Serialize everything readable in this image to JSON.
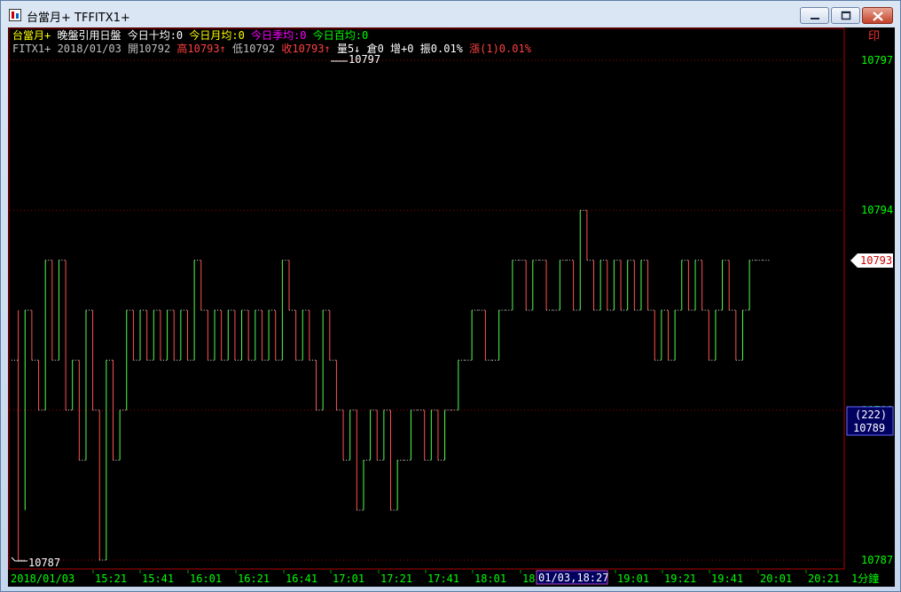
{
  "window": {
    "title": "台當月+ TFFITX1+"
  },
  "info_line1": [
    {
      "text": "台當月+",
      "color": "#ffff00"
    },
    {
      "text": "晚盤引用日盤",
      "color": "#ffffff"
    },
    {
      "text": "今日十均:0",
      "color": "#ffffff"
    },
    {
      "text": "今日月均:0",
      "color": "#ffff00"
    },
    {
      "text": "今日季均:0",
      "color": "#ff00ff"
    },
    {
      "text": "今日百均:0",
      "color": "#00ff00"
    }
  ],
  "info_line2": [
    {
      "text": "FITX1+",
      "color": "#c0c0c0"
    },
    {
      "text": "2018/01/03",
      "color": "#c0c0c0"
    },
    {
      "text": "開10792",
      "color": "#c0c0c0"
    },
    {
      "text": "高10793↑",
      "color": "#ff4040"
    },
    {
      "text": "低10792",
      "color": "#c0c0c0"
    },
    {
      "text": "收10793↑",
      "color": "#ff4040"
    },
    {
      "text": "量5↓",
      "color": "#ffffff"
    },
    {
      "text": "倉0",
      "color": "#ffffff"
    },
    {
      "text": "增+0",
      "color": "#ffffff"
    },
    {
      "text": "振0.01%",
      "color": "#ffffff"
    },
    {
      "text": "漲(1)0.01%",
      "color": "#ff4040"
    }
  ],
  "print_button": "印",
  "chart_data": {
    "type": "bar",
    "subtype": "1-minute price ticks",
    "symbol": "FITX1+",
    "date": "2018/01/03",
    "y_ticks": [
      10797,
      10794,
      10790,
      10787
    ],
    "ylim": [
      10786.5,
      10797.8
    ],
    "x_tick_labels": [
      "2018/01/03",
      "15:21",
      "15:41",
      "16:01",
      "16:21",
      "16:41",
      "17:01",
      "17:21",
      "17:41",
      "18:01",
      "18",
      "19:01",
      "19:21",
      "19:41",
      "20:01",
      "20:21"
    ],
    "x_label_right": "1分鐘",
    "cursor_time_label": "01/03,18:27",
    "last_price_marker": "10793",
    "cursor_info": {
      "count": "(222)",
      "price": "10789"
    },
    "high_label": "10797",
    "low_label": "10787",
    "segments": [
      [
        0,
        2,
        10791,
        10791
      ],
      [
        2,
        4,
        10792,
        10787
      ],
      [
        4,
        6,
        10788,
        10792
      ],
      [
        6,
        8,
        10792,
        10791
      ],
      [
        8,
        10,
        10791,
        10790
      ],
      [
        10,
        12,
        10790,
        10793
      ],
      [
        12,
        14,
        10793,
        10791
      ],
      [
        14,
        16,
        10791,
        10793
      ],
      [
        16,
        18,
        10793,
        10790
      ],
      [
        18,
        20,
        10790,
        10791
      ],
      [
        20,
        22,
        10791,
        10789
      ],
      [
        22,
        24,
        10789,
        10792
      ],
      [
        24,
        26,
        10792,
        10790
      ],
      [
        26,
        28,
        10790,
        10787
      ],
      [
        28,
        30,
        10787,
        10791
      ],
      [
        30,
        32,
        10791,
        10789
      ],
      [
        32,
        34,
        10789,
        10790
      ],
      [
        34,
        36,
        10790,
        10792
      ],
      [
        36,
        38,
        10792,
        10791
      ],
      [
        38,
        40,
        10791,
        10792
      ],
      [
        40,
        42,
        10792,
        10791
      ],
      [
        42,
        44,
        10791,
        10792
      ],
      [
        44,
        46,
        10792,
        10791
      ],
      [
        46,
        48,
        10791,
        10792
      ],
      [
        48,
        50,
        10792,
        10791
      ],
      [
        50,
        52,
        10791,
        10792
      ],
      [
        52,
        54,
        10792,
        10791
      ],
      [
        54,
        56,
        10791,
        10793
      ],
      [
        56,
        58,
        10793,
        10792
      ],
      [
        58,
        60,
        10792,
        10791
      ],
      [
        60,
        62,
        10791,
        10792
      ],
      [
        62,
        64,
        10792,
        10791
      ],
      [
        64,
        66,
        10791,
        10792
      ],
      [
        66,
        68,
        10792,
        10791
      ],
      [
        68,
        70,
        10791,
        10792
      ],
      [
        70,
        72,
        10792,
        10791
      ],
      [
        72,
        74,
        10791,
        10792
      ],
      [
        74,
        76,
        10792,
        10791
      ],
      [
        76,
        78,
        10791,
        10792
      ],
      [
        78,
        80,
        10792,
        10791
      ],
      [
        80,
        82,
        10791,
        10793
      ],
      [
        82,
        84,
        10793,
        10792
      ],
      [
        84,
        86,
        10792,
        10791
      ],
      [
        86,
        88,
        10791,
        10792
      ],
      [
        88,
        90,
        10792,
        10791
      ],
      [
        90,
        92,
        10791,
        10790
      ],
      [
        92,
        94,
        10790,
        10792
      ],
      [
        94,
        96,
        10792,
        10791
      ],
      [
        96,
        98,
        10791,
        10790
      ],
      [
        98,
        100,
        10790,
        10789
      ],
      [
        100,
        102,
        10789,
        10790
      ],
      [
        102,
        104,
        10790,
        10788
      ],
      [
        104,
        106,
        10788,
        10789
      ],
      [
        106,
        108,
        10789,
        10790
      ],
      [
        108,
        110,
        10790,
        10789
      ],
      [
        110,
        112,
        10789,
        10790
      ],
      [
        112,
        114,
        10790,
        10788
      ],
      [
        114,
        116,
        10788,
        10789
      ],
      [
        116,
        118,
        10789,
        10789
      ],
      [
        118,
        120,
        10789,
        10790
      ],
      [
        120,
        122,
        10790,
        10790
      ],
      [
        122,
        124,
        10790,
        10789
      ],
      [
        124,
        126,
        10789,
        10790
      ],
      [
        126,
        128,
        10790,
        10789
      ],
      [
        128,
        130,
        10789,
        10790
      ],
      [
        130,
        132,
        10790,
        10790
      ],
      [
        132,
        134,
        10790,
        10791
      ],
      [
        134,
        136,
        10791,
        10791
      ],
      [
        136,
        138,
        10791,
        10792
      ],
      [
        138,
        140,
        10792,
        10792
      ],
      [
        140,
        142,
        10792,
        10791
      ],
      [
        142,
        144,
        10791,
        10791
      ],
      [
        144,
        146,
        10791,
        10792
      ],
      [
        146,
        148,
        10792,
        10792
      ],
      [
        148,
        150,
        10792,
        10793
      ],
      [
        150,
        152,
        10793,
        10793
      ],
      [
        152,
        154,
        10793,
        10792
      ],
      [
        154,
        156,
        10792,
        10793
      ],
      [
        156,
        158,
        10793,
        10793
      ],
      [
        158,
        160,
        10793,
        10792
      ],
      [
        160,
        162,
        10792,
        10792
      ],
      [
        162,
        164,
        10792,
        10793
      ],
      [
        164,
        166,
        10793,
        10793
      ],
      [
        166,
        168,
        10793,
        10792
      ],
      [
        168,
        170,
        10792,
        10794
      ],
      [
        170,
        172,
        10794,
        10793
      ],
      [
        172,
        174,
        10793,
        10792
      ],
      [
        174,
        176,
        10792,
        10793
      ],
      [
        176,
        178,
        10793,
        10792
      ],
      [
        178,
        180,
        10792,
        10793
      ],
      [
        180,
        182,
        10793,
        10792
      ],
      [
        182,
        184,
        10792,
        10793
      ],
      [
        184,
        186,
        10793,
        10792
      ],
      [
        186,
        188,
        10792,
        10793
      ],
      [
        188,
        190,
        10793,
        10792
      ],
      [
        190,
        192,
        10792,
        10791
      ],
      [
        192,
        194,
        10791,
        10792
      ],
      [
        194,
        196,
        10792,
        10791
      ],
      [
        196,
        198,
        10791,
        10792
      ],
      [
        198,
        200,
        10792,
        10793
      ],
      [
        200,
        202,
        10793,
        10792
      ],
      [
        202,
        204,
        10792,
        10793
      ],
      [
        204,
        206,
        10793,
        10792
      ],
      [
        206,
        208,
        10792,
        10791
      ],
      [
        208,
        210,
        10791,
        10792
      ],
      [
        210,
        212,
        10792,
        10793
      ],
      [
        212,
        214,
        10793,
        10792
      ],
      [
        214,
        216,
        10792,
        10791
      ],
      [
        216,
        218,
        10791,
        10792
      ],
      [
        218,
        220,
        10792,
        10793
      ],
      [
        220,
        222,
        10793,
        10793
      ],
      [
        222,
        224,
        10793,
        10793
      ]
    ]
  }
}
